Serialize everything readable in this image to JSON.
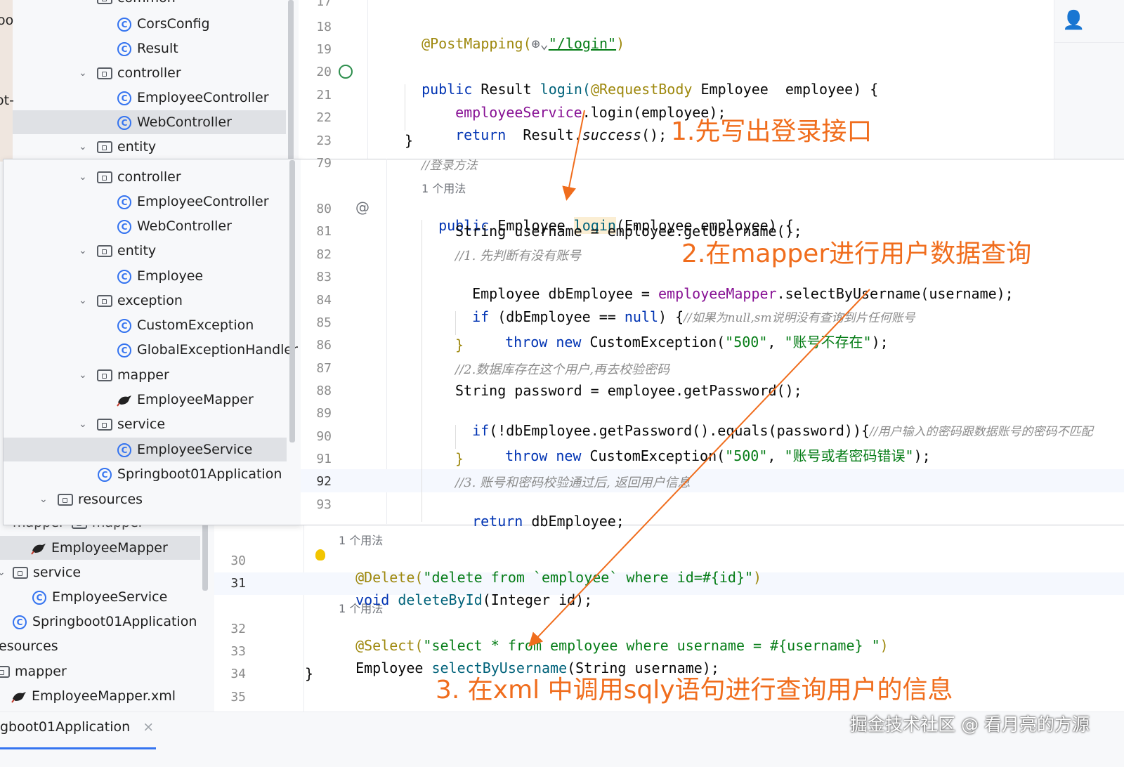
{
  "back_tree": {
    "items": [
      {
        "label": "CorsConfig",
        "type": "class"
      },
      {
        "label": "Result",
        "type": "class"
      },
      {
        "label": "controller",
        "type": "folder"
      },
      {
        "label": "EmployeeController",
        "type": "class"
      },
      {
        "label": "WebController",
        "type": "class"
      },
      {
        "label": "entity",
        "type": "folder"
      }
    ],
    "bottom_items": [
      {
        "label": "EmployeeMapper",
        "type": "mapper"
      },
      {
        "label": "service",
        "type": "folder"
      },
      {
        "label": "EmployeeService",
        "type": "class"
      },
      {
        "label": "Springboot01Application",
        "type": "app"
      },
      {
        "label": "esources",
        "type": "folder"
      },
      {
        "label": "mapper",
        "type": "folder"
      },
      {
        "label": "EmployeeMapper.xml",
        "type": "mapper"
      }
    ],
    "partial_labels": [
      "common",
      "mapper",
      "mapper"
    ]
  },
  "front_tree": {
    "items": [
      {
        "label": "controller",
        "type": "folder"
      },
      {
        "label": "EmployeeController",
        "type": "class"
      },
      {
        "label": "WebController",
        "type": "class"
      },
      {
        "label": "entity",
        "type": "folder"
      },
      {
        "label": "Employee",
        "type": "class"
      },
      {
        "label": "exception",
        "type": "folder"
      },
      {
        "label": "CustomException",
        "type": "class"
      },
      {
        "label": "GlobalExceptionHandler",
        "type": "class"
      },
      {
        "label": "mapper",
        "type": "folder"
      },
      {
        "label": "EmployeeMapper",
        "type": "mapper"
      },
      {
        "label": "service",
        "type": "folder"
      },
      {
        "label": "EmployeeService",
        "type": "class"
      },
      {
        "label": "Springboot01Application",
        "type": "app"
      },
      {
        "label": "resources",
        "type": "folder"
      }
    ]
  },
  "left_edge_text": [
    "oo",
    "ot-"
  ],
  "controller_code": {
    "line_numbers": [
      "17",
      "18",
      "19",
      "20",
      "21",
      "22",
      "23"
    ],
    "post_mapping": "@PostMapping(",
    "post_url": "\"/login\"",
    "line20": [
      "public ",
      "Result ",
      "login(",
      "@RequestBody ",
      "Employee  employee) {"
    ],
    "line21": [
      "employeeService",
      ".login(employee);"
    ],
    "line22": [
      "return",
      "  Result.",
      "success",
      "();"
    ],
    "line23": "}"
  },
  "service_code": {
    "line_numbers": [
      "79",
      "80",
      "81",
      "82",
      "83",
      "84",
      "85",
      "86",
      "87",
      "88",
      "89",
      "90",
      "91",
      "92",
      "93"
    ],
    "comment79": "//登录方法",
    "usage": "1 个用法",
    "line80": [
      "public ",
      "Employee ",
      "login",
      "(Employee employee) {"
    ],
    "line81": "String username = employee.getUsername();",
    "line82": "//1. 先判断有没有账号",
    "line83": [
      "Employee dbEmployee = ",
      "employeeMapper",
      ".selectByUsername(username);"
    ],
    "line84": [
      "if",
      " (dbEmployee == ",
      "null",
      ") {",
      "//如果为null,sm说明没有查询到片任何账号"
    ],
    "line85": [
      "throw new ",
      "CustomException(",
      "\"500\"",
      ", ",
      "\"账号不存在\"",
      ");"
    ],
    "line86": "}",
    "line87": "//2.数据库存在这个用户,再去校验密码",
    "line88": "String password = employee.getPassword();",
    "line89": [
      "if",
      "(!dbEmployee.getPassword().equals(password)){",
      "//用户输入的密码跟数据账号的密码不匹配"
    ],
    "line90": [
      "throw new ",
      "CustomException(",
      "\"500\"",
      ", ",
      "\"账号或者密码错误\"",
      ");"
    ],
    "line91": "}",
    "line92": "//3. 账号和密码校验通过后, 返回用户信息",
    "line93": [
      "return",
      " dbEmployee;"
    ]
  },
  "mapper_code": {
    "line_numbers": [
      "30",
      "31",
      "32",
      "33",
      "34",
      "35"
    ],
    "usage": "1 个用法",
    "line30": [
      "@Delete(",
      "\"delete from `employee` where id=#{id}\"",
      ")"
    ],
    "line31": [
      "void ",
      "deleteById",
      "(Integer id);"
    ],
    "line32": [
      "@Select(",
      "\"select * from employee where username = #{username} \"",
      ")"
    ],
    "line33": [
      "Employee ",
      "selectByUsername",
      "(String username);"
    ],
    "line34": "}"
  },
  "annotations": {
    "step1": "1.先写出登录接口",
    "step2": "2.在mapper进行用户数据查询",
    "step3": "3. 在xml 中调用sqly语句进行查询用户的信息"
  },
  "bottom_tab": {
    "label": "gboot01Application",
    "close": "×"
  },
  "watermark": "掘金技术社区 @ 看月亮的方源",
  "colors": {
    "callout": "#f06d1d",
    "selection": "#dfe1e5",
    "keyword": "#0033b3",
    "string": "#067d17",
    "annotation": "#9e880d"
  }
}
